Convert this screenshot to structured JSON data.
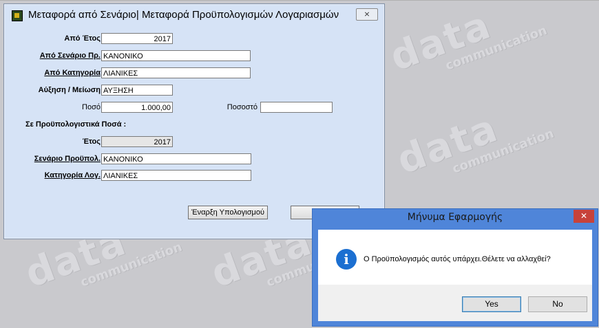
{
  "dialog": {
    "title": "Μεταφορά από Σενάριο| Μεταφορά Προϋπολογισμών Λογαριασμών",
    "close_label": "⨯",
    "from_year_label": "Από Έτος",
    "from_year_value": "2017",
    "from_scenario_label": "Από Σενάριο Πρ.",
    "from_scenario_value": "ΚΑΝΟΝΙΚΟ",
    "from_category_label": "Από Κατηγορία",
    "from_category_value": "ΛΙΑΝΙΚΕΣ",
    "change_label": "Αύξηση / Μείωση",
    "change_value": "ΑΥΞΗΣΗ",
    "amount_label": "Ποσό",
    "amount_value": "1.000,00",
    "percent_label": "Ποσοστό",
    "percent_value": "",
    "section_label": "Σε Προϋπολογιστικά Ποσά :",
    "year_label": "Έτος",
    "year_value": "2017",
    "budget_scenario_label": "Σενάριο Προϋπολ.",
    "budget_scenario_value": "ΚΑΝΟΝΙΚΟ",
    "account_category_label": "Κατηγορία Λογ.",
    "account_category_value": "ΛΙΑΝΙΚΕΣ",
    "start_button": "Έναρξη Υπολογισμού",
    "second_button": ""
  },
  "message_box": {
    "title": "Μήνυμα Εφαρμογής",
    "close_label": "✕",
    "icon": "info-icon",
    "text": "Ο Προϋπολογισμός αυτός υπάρχει.Θέλετε να αλλαχθεί?",
    "yes_label": "Yes",
    "no_label": "No"
  },
  "watermark": {
    "brand": "data",
    "subtitle": "communication"
  },
  "colors": {
    "dialog_bg": "#d6e3f6",
    "msg_frame": "#4f85d9",
    "close_red": "#c7423a",
    "info_blue": "#1b6fd1"
  }
}
